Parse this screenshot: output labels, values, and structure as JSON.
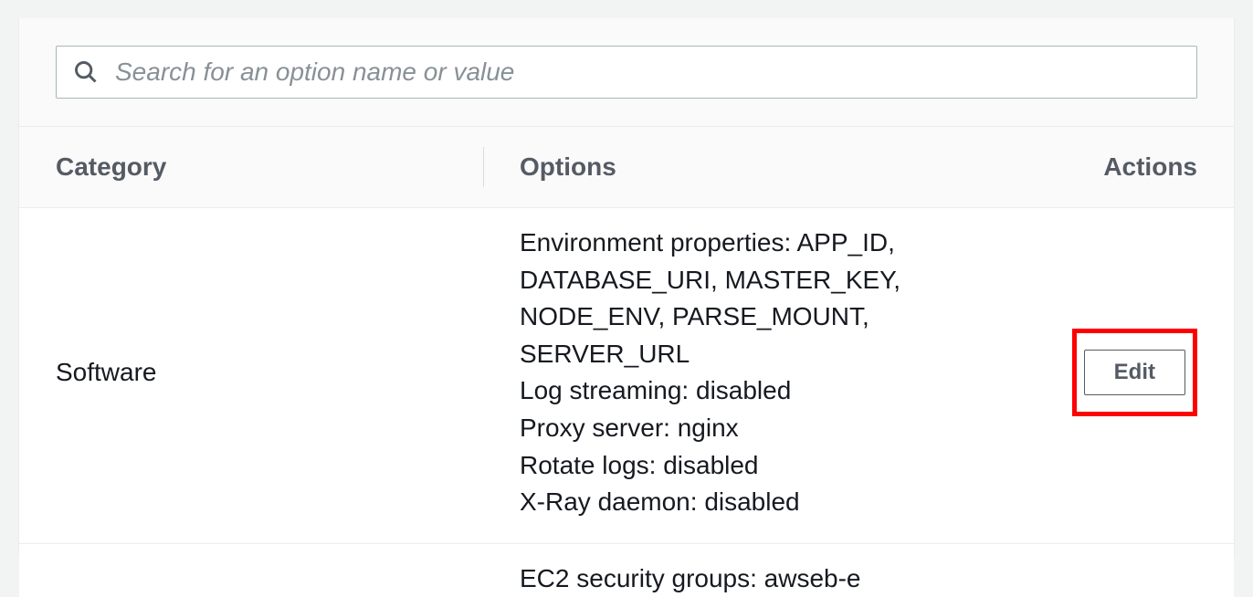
{
  "search": {
    "placeholder": "Search for an option name or value"
  },
  "headers": {
    "category": "Category",
    "options": "Options",
    "actions": "Actions"
  },
  "rows": [
    {
      "category": "Software",
      "options": "Environment properties: APP_ID, DATABASE_URI, MASTER_KEY, NODE_ENV, PARSE_MOUNT, SERVER_URL\nLog streaming: disabled\nProxy server: nginx\nRotate logs: disabled\nX-Ray daemon: disabled",
      "action_label": "Edit"
    }
  ],
  "partial_next": "EC2 security groups: awseb-e"
}
